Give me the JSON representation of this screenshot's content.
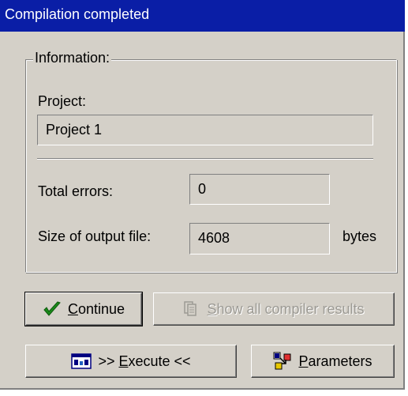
{
  "window": {
    "title": "Compilation completed"
  },
  "information": {
    "legend": "Information:",
    "project_label": "Project:",
    "project_value": "Project 1",
    "total_errors_label": "Total errors:",
    "total_errors_value": "0",
    "output_size_label": "Size of output file:",
    "output_size_value": "4608",
    "output_size_unit": "bytes"
  },
  "buttons": {
    "continue": {
      "hotkey": "C",
      "rest": "ontinue",
      "icon": "checkmark-icon",
      "icon_color": "#1a8a1a"
    },
    "show_results": {
      "hotkey": "S",
      "rest": "how all compiler results",
      "icon": "document-stack-icon",
      "enabled": false
    },
    "execute": {
      "prefix": ">> ",
      "hotkey": "E",
      "rest": "xecute <<",
      "icon": "run-window-icon"
    },
    "parameters": {
      "hotkey": "P",
      "rest": "arameters",
      "icon": "parameters-icon"
    }
  },
  "colors": {
    "titlebar": "#0a1ea6",
    "face": "#d4d0c8"
  }
}
